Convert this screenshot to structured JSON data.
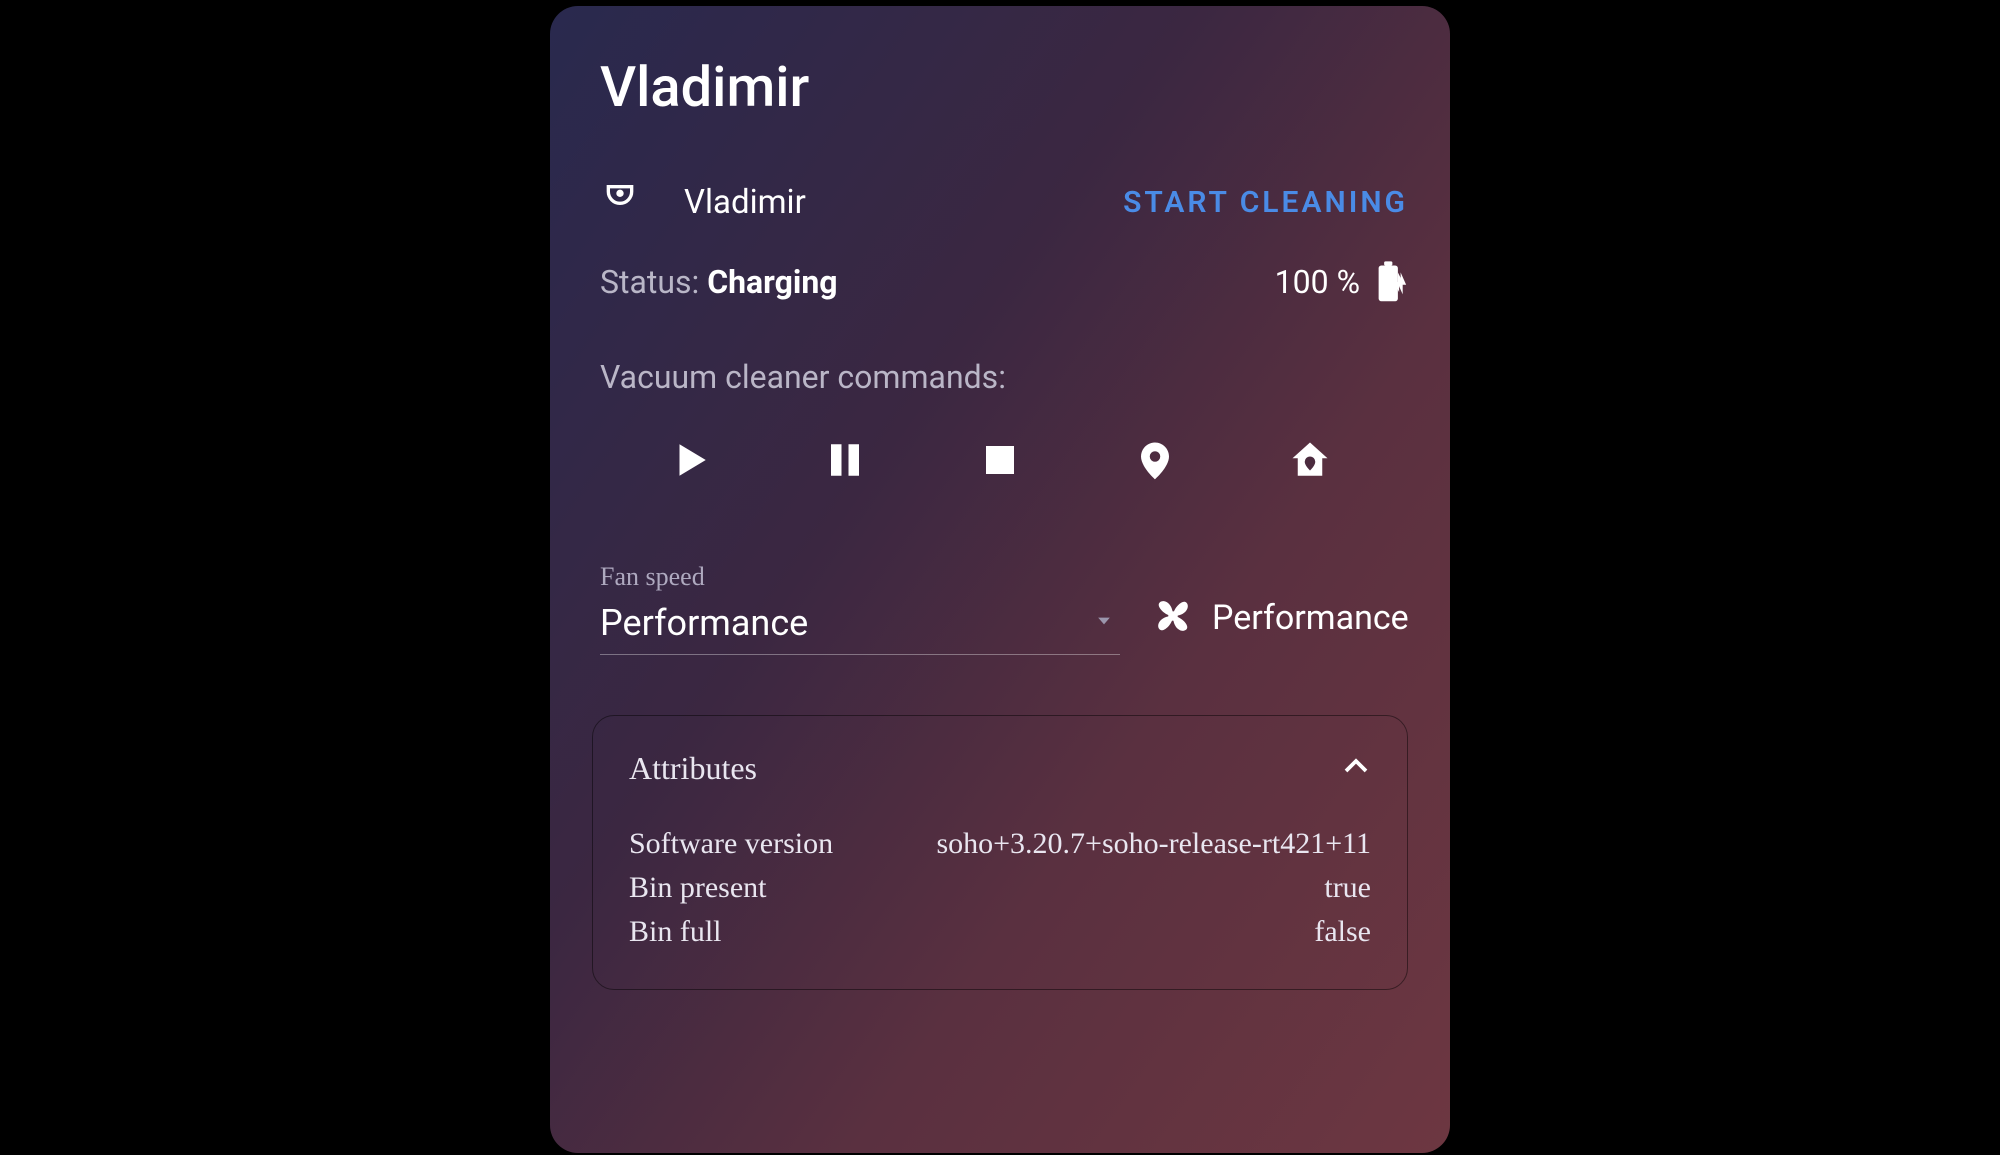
{
  "card": {
    "title": "Vladimir",
    "device_name": "Vladimir",
    "start_button": "START CLEANING",
    "status_label": "Status: ",
    "status_value": "Charging",
    "battery_pct": "100 %",
    "commands_label": "Vacuum cleaner commands:",
    "commands": {
      "play": "play",
      "pause": "pause",
      "stop": "stop",
      "locate": "locate",
      "home": "return-home"
    },
    "fan": {
      "label": "Fan speed",
      "selected": "Performance",
      "display": "Performance"
    },
    "attributes": {
      "heading": "Attributes",
      "rows": [
        {
          "key": "Software version",
          "val": "soho+3.20.7+soho-release-rt421+11"
        },
        {
          "key": "Bin present",
          "val": "true"
        },
        {
          "key": "Bin full",
          "val": "false"
        }
      ]
    }
  },
  "colors": {
    "accent": "#4a8be6"
  }
}
